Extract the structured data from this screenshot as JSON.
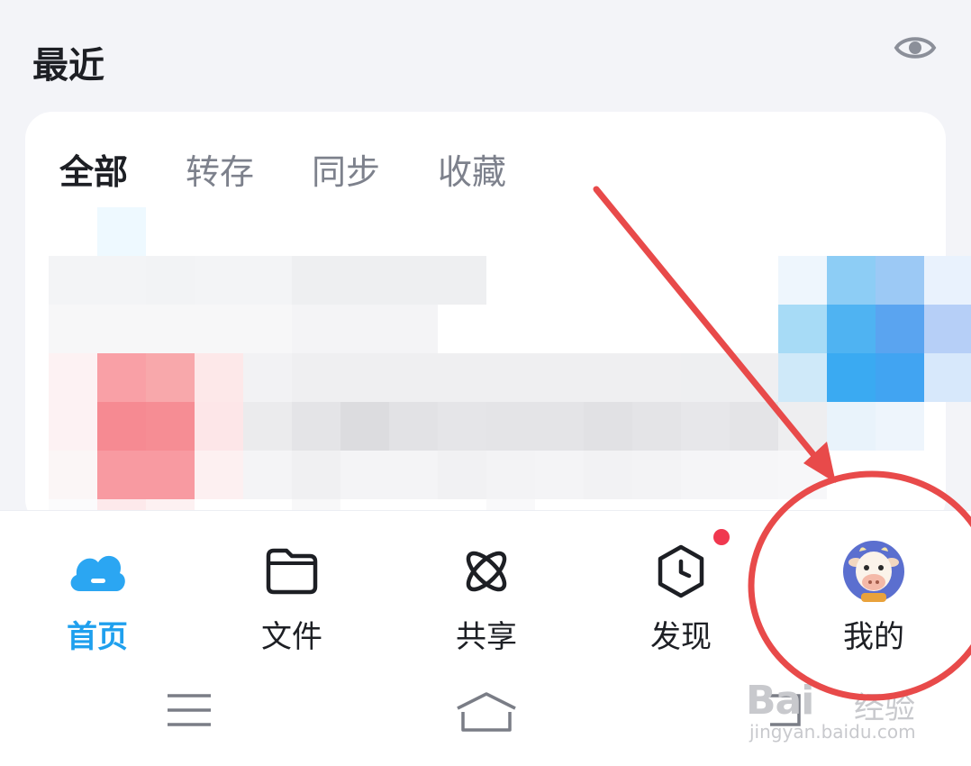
{
  "header": {
    "title": "最近",
    "eye_icon": "eye-icon"
  },
  "tabs": [
    {
      "label": "全部",
      "active": true
    },
    {
      "label": "转存",
      "active": false
    },
    {
      "label": "同步",
      "active": false
    },
    {
      "label": "收藏",
      "active": false
    }
  ],
  "bottom_nav": [
    {
      "label": "首页",
      "icon": "cloud-home-icon",
      "active": true
    },
    {
      "label": "文件",
      "icon": "folder-icon",
      "active": false
    },
    {
      "label": "共享",
      "icon": "orbit-share-icon",
      "active": false
    },
    {
      "label": "发现",
      "icon": "clock-box-icon",
      "active": false,
      "badge": true
    },
    {
      "label": "我的",
      "icon": "avatar-cow-icon",
      "active": false
    }
  ],
  "system_nav": {
    "menu_icon": "menu-icon",
    "home_icon": "home-icon",
    "back_icon": "back-icon"
  },
  "colors": {
    "accent": "#1fa0ee",
    "badge": "#f0384f",
    "annotation": "#e84a4a"
  },
  "watermark": {
    "brand": "Bai",
    "brand2": "经验",
    "url": "jingyan.baidu.com"
  }
}
